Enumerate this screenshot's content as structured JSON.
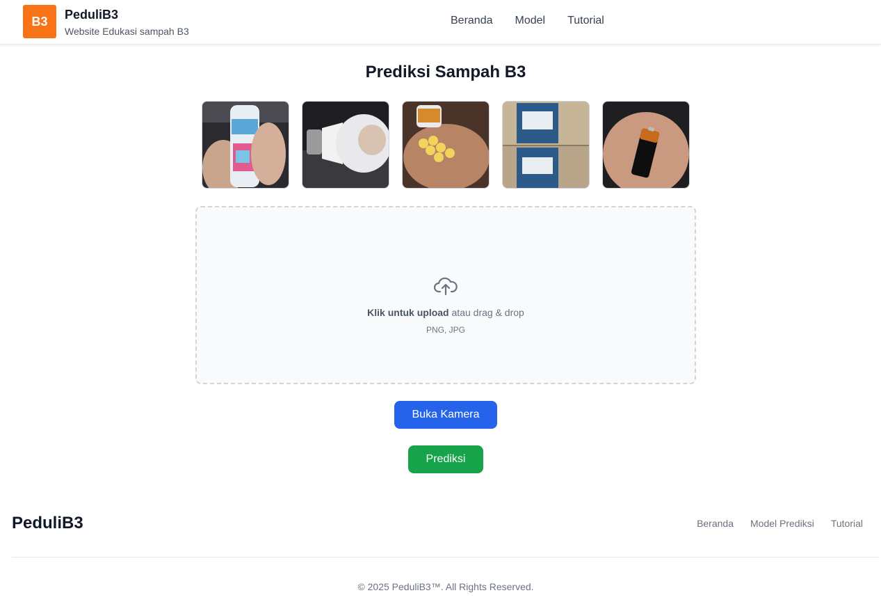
{
  "header": {
    "logo_text": "B3",
    "brand_name": "PeduliB3",
    "brand_tagline": "Website Edukasi sampah B3",
    "nav": [
      {
        "label": "Beranda"
      },
      {
        "label": "Model"
      },
      {
        "label": "Tutorial"
      }
    ]
  },
  "main": {
    "title": "Prediksi Sampah B3",
    "samples": [
      {
        "icon": "spray-can-image"
      },
      {
        "icon": "light-bulb-image"
      },
      {
        "icon": "pills-image"
      },
      {
        "icon": "detergent-boxes-image"
      },
      {
        "icon": "battery-image"
      }
    ],
    "upload": {
      "icon": "cloud-upload-icon",
      "click_text": "Klik untuk upload",
      "drag_text": " atau drag & drop",
      "formats": "PNG, JPG"
    },
    "camera_button": "Buka Kamera",
    "predict_button": "Prediksi"
  },
  "footer": {
    "brand": "PeduliB3",
    "links": [
      {
        "label": "Beranda"
      },
      {
        "label": "Model Prediksi"
      },
      {
        "label": "Tutorial"
      }
    ],
    "copyright": "© 2025 PeduliB3™. All Rights Reserved."
  },
  "colors": {
    "accent_orange": "#f97316",
    "camera_blue": "#2563eb",
    "predict_green": "#16a34a"
  }
}
